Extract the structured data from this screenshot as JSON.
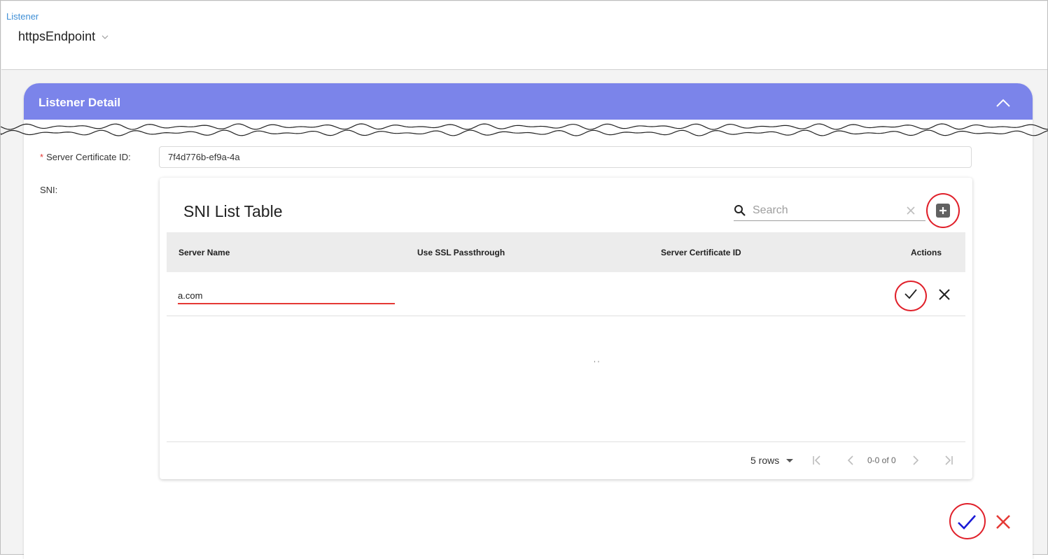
{
  "header": {
    "breadcrumb": "Listener",
    "selected_listener": "httpsEndpoint"
  },
  "card": {
    "title": "Listener Detail"
  },
  "form": {
    "server_cert_label": "Server Certificate ID:",
    "server_cert_value": "7f4d776b-ef9a-4a",
    "sni_label": "SNI:"
  },
  "sni_table": {
    "title": "SNI List Table",
    "search_placeholder": "Search",
    "columns": [
      "Server Name",
      "Use SSL Passthrough",
      "Server Certificate ID",
      "Actions"
    ],
    "editing_row": {
      "server_name": "a.com"
    },
    "empty_fragment": ", ,",
    "rows_per_page": "5 rows",
    "pagination_text": "0-0 of 0"
  },
  "colors": {
    "header_accent": "#7b84ea",
    "breadcrumb": "#3f8fd6",
    "confirm": "#1a1ad6",
    "cancel": "#e53935",
    "annotation": "#e0202a"
  }
}
